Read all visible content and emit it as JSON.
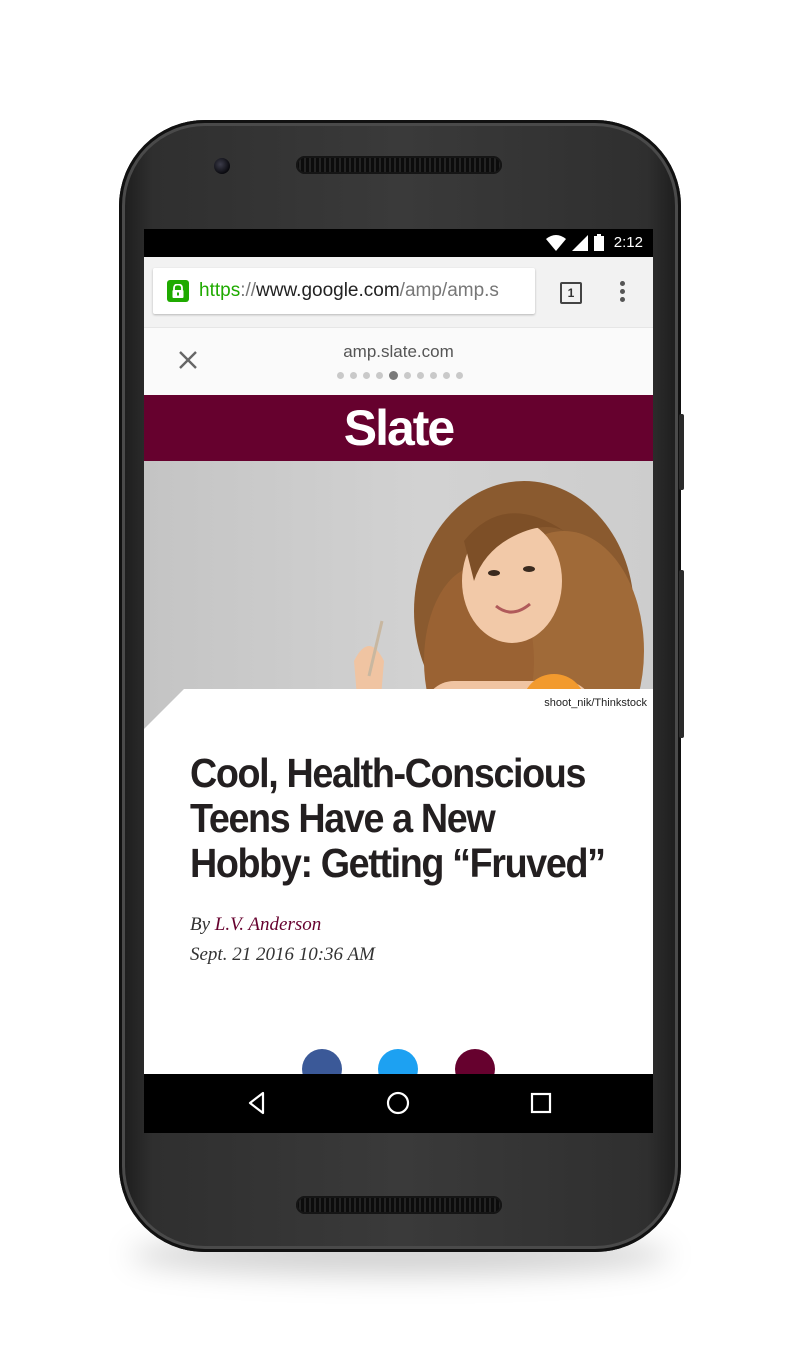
{
  "status_bar": {
    "time": "2:12"
  },
  "browser": {
    "url_scheme": "https",
    "url_separator": "://",
    "url_host": "www.google.com",
    "url_path": "/amp/amp.s",
    "tab_count": "1"
  },
  "amp_viewer": {
    "domain": "amp.slate.com",
    "page_dots": 10,
    "active_dot": 5
  },
  "site": {
    "logo": "Slate",
    "brand_color": "#66012e"
  },
  "hero": {
    "photo_credit": "shoot_nik/Thinkstock"
  },
  "article": {
    "headline": "Cool, Health-Conscious Teens Have a New Hobby: Getting “Fruved”",
    "byline_prefix": "By ",
    "author": "L.V. Anderson",
    "date": "Sept. 21 2016 10:36 AM"
  },
  "share": [
    "facebook-icon",
    "twitter-icon",
    "email-icon"
  ],
  "nav_bar": [
    "back-icon",
    "home-icon",
    "recents-icon"
  ]
}
